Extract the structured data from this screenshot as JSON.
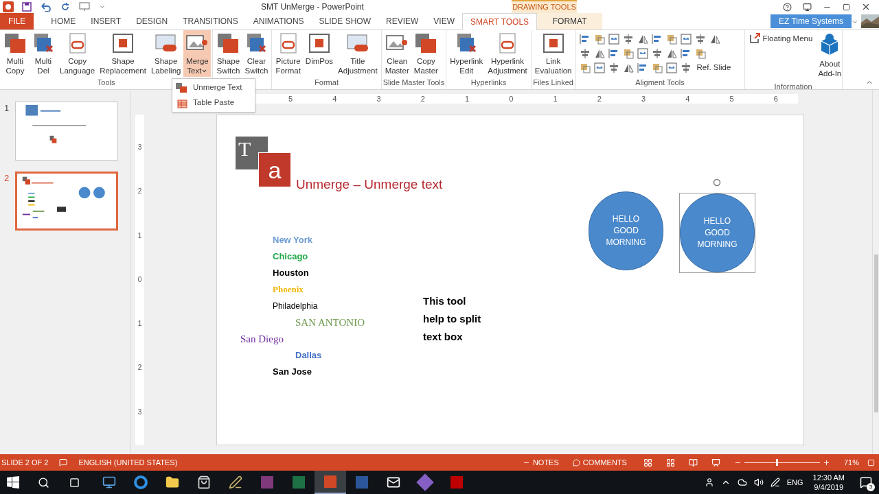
{
  "title_bar": {
    "title": "SMT UnMerge - PowerPoint",
    "contextual_label": "DRAWING TOOLS",
    "account": "EZ Time Systems"
  },
  "tabs": [
    {
      "label": "FILE",
      "kind": "file",
      "selected": false
    },
    {
      "label": "HOME",
      "kind": "normal",
      "selected": false
    },
    {
      "label": "INSERT",
      "kind": "normal",
      "selected": false
    },
    {
      "label": "DESIGN",
      "kind": "normal",
      "selected": false
    },
    {
      "label": "TRANSITIONS",
      "kind": "normal",
      "selected": false
    },
    {
      "label": "ANIMATIONS",
      "kind": "normal",
      "selected": false
    },
    {
      "label": "SLIDE SHOW",
      "kind": "normal",
      "selected": false
    },
    {
      "label": "REVIEW",
      "kind": "normal",
      "selected": false
    },
    {
      "label": "VIEW",
      "kind": "normal",
      "selected": false
    },
    {
      "label": "SMART TOOLS",
      "kind": "normal",
      "selected": true
    },
    {
      "label": "FORMAT",
      "kind": "contextual",
      "selected": false
    }
  ],
  "ribbon": {
    "groups": [
      {
        "label": "Tools",
        "buttons": [
          {
            "lines": [
              "Multi",
              "Copy"
            ],
            "pressed": false
          },
          {
            "lines": [
              "Multi",
              "Del"
            ],
            "pressed": false
          },
          {
            "lines": [
              "Copy",
              "Language"
            ],
            "pressed": false
          },
          {
            "lines": [
              "Shape",
              "Replacement"
            ],
            "pressed": false
          },
          {
            "lines": [
              "Shape",
              "Labeling"
            ],
            "pressed": false
          },
          {
            "lines": [
              "Merge",
              "Text"
            ],
            "pressed": true,
            "dropdown": true
          }
        ]
      },
      {
        "buttons": [
          {
            "lines": [
              "Shape",
              "Switch"
            ],
            "pressed": false
          },
          {
            "lines": [
              "Clear",
              "Switch"
            ],
            "pressed": false
          }
        ]
      },
      {
        "label": "Format",
        "buttons": [
          {
            "lines": [
              "Picture",
              "Format"
            ],
            "pressed": false
          },
          {
            "lines": [
              "DimPos"
            ],
            "pressed": false
          },
          {
            "lines": [
              "Title",
              "Adjustment"
            ],
            "pressed": false
          }
        ]
      },
      {
        "label": "Slide Master Tools",
        "buttons": [
          {
            "lines": [
              "Clean",
              "Master"
            ],
            "pressed": false
          },
          {
            "lines": [
              "Copy",
              "Master"
            ],
            "pressed": false
          }
        ]
      },
      {
        "label": "Hyperlinks",
        "buttons": [
          {
            "lines": [
              "Hyperlink",
              "Edit"
            ],
            "pressed": false
          },
          {
            "lines": [
              "Hyperlink",
              "Adjustment"
            ],
            "pressed": false
          }
        ]
      },
      {
        "label": "Files Linked",
        "buttons": [
          {
            "lines": [
              "Link",
              "Evaluation"
            ],
            "pressed": false
          }
        ]
      }
    ],
    "alignment": {
      "label": "Aligment Tools",
      "ref_slide": "Ref. Slide"
    },
    "information": {
      "label": "Information",
      "floating_menu": "Floating Menu",
      "about": [
        "About",
        "Add-In"
      ]
    }
  },
  "dropdown_menu": [
    {
      "label": "Unmerge Text"
    },
    {
      "label": "Table Paste"
    }
  ],
  "rulers": {
    "horizontal": [
      "5",
      "4",
      "3",
      "2",
      "1",
      "0",
      "1",
      "2",
      "3",
      "4",
      "5",
      "6"
    ],
    "vertical": [
      "3",
      "2",
      "1",
      "0",
      "1",
      "2",
      "3"
    ]
  },
  "slides": [
    {
      "number": "1",
      "selected": false
    },
    {
      "number": "2",
      "selected": true
    }
  ],
  "slide": {
    "logo": [
      "T",
      "a"
    ],
    "title": "Unmerge – Unmerge text",
    "cities": [
      {
        "text": "New York",
        "color": "#6b9bd1",
        "kind": "bold"
      },
      {
        "text": "Chicago",
        "color": "#22a84a",
        "kind": "bold"
      },
      {
        "text": "Houston",
        "color": "#000000",
        "kind": "bold"
      },
      {
        "text": "Phoenix",
        "color": "#f2b705",
        "kind": "boldserif"
      },
      {
        "text": "Philadelphia",
        "color": "#000000",
        "kind": "plain"
      },
      {
        "text": "SAN ANTONIO",
        "color": "#6e9a4f",
        "kind": "serifindent"
      },
      {
        "text": "San Diego",
        "color": "#7030a0",
        "kind": "serifoutdent"
      },
      {
        "text": "Dallas",
        "color": "#4472c4",
        "kind": "boldindent"
      },
      {
        "text": "San Jose",
        "color": "#000000",
        "kind": "bold"
      }
    ],
    "note": [
      "This tool",
      "help to split",
      "text box"
    ],
    "circles": [
      {
        "lines": [
          "HELLO",
          "GOOD",
          "MORNING"
        ],
        "selected": false
      },
      {
        "lines": [
          "HELLO",
          "GOOD",
          "MORNING"
        ],
        "selected": true
      }
    ]
  },
  "status_bar": {
    "slide": "SLIDE 2 OF 2",
    "language": "ENGLISH (UNITED STATES)",
    "notes": "NOTES",
    "comments": "COMMENTS",
    "zoom": "71%",
    "zoom_slider": {
      "level": 0.43
    }
  },
  "taskbar": {
    "apps": [
      {
        "selected": false
      },
      {
        "selected": false
      },
      {
        "selected": false
      },
      {
        "selected": false
      },
      {
        "selected": false
      },
      {
        "selected": false
      },
      {
        "selected": false
      },
      {
        "selected": true
      },
      {
        "selected": false
      },
      {
        "selected": false
      },
      {
        "selected": false
      },
      {
        "selected": false
      }
    ],
    "language": "ENG",
    "time": "12:30 AM",
    "date": "9/4/2019",
    "notifications": "3"
  }
}
